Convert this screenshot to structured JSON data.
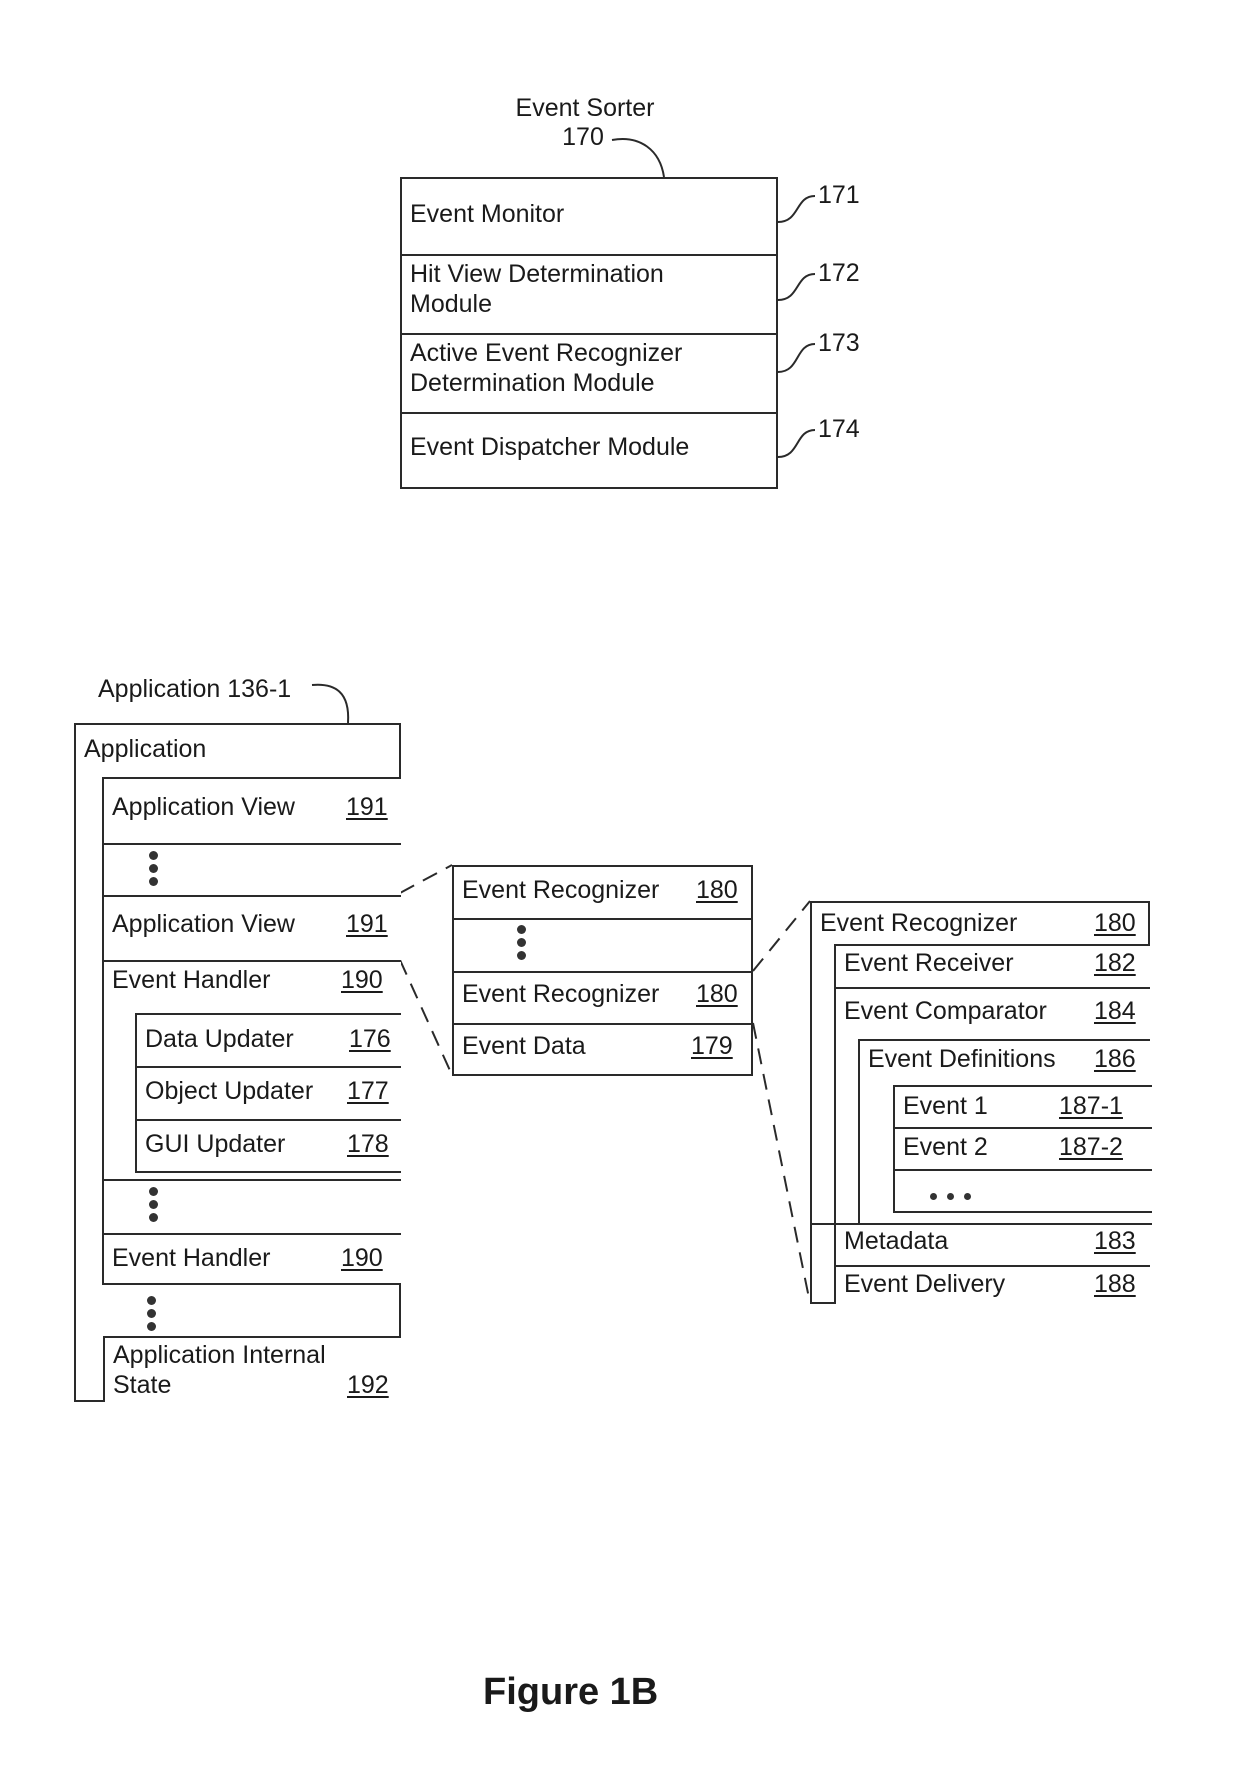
{
  "event_sorter": {
    "title": "Event Sorter",
    "ref": "170",
    "modules": [
      {
        "lines": [
          "Event Monitor"
        ],
        "ref": "171"
      },
      {
        "lines": [
          "Hit View Determination",
          "Module"
        ],
        "ref": "172"
      },
      {
        "lines": [
          "Active Event Recognizer",
          "Determination Module"
        ],
        "ref": "173"
      },
      {
        "lines": [
          "Event Dispatcher Module"
        ],
        "ref": "174"
      }
    ]
  },
  "application": {
    "caption": "Application 136-1",
    "header": "Application",
    "app_view_1": {
      "label": "Application View",
      "ref": "191"
    },
    "app_view_2": {
      "label": "Application View",
      "ref": "191"
    },
    "event_handler_1": {
      "label": "Event Handler",
      "ref": "190"
    },
    "updaters": [
      {
        "label": "Data Updater",
        "ref": "176"
      },
      {
        "label": "Object Updater",
        "ref": "177"
      },
      {
        "label": "GUI Updater",
        "ref": "178"
      }
    ],
    "event_handler_2": {
      "label": "Event Handler",
      "ref": "190"
    },
    "internal_state": {
      "line1": "Application Internal",
      "line2": "State",
      "ref": "192"
    }
  },
  "recognizers": {
    "rec_1": {
      "label": "Event Recognizer",
      "ref": "180"
    },
    "rec_2": {
      "label": "Event Recognizer",
      "ref": "180"
    },
    "event_data": {
      "label": "Event Data",
      "ref": "179"
    }
  },
  "recognizer_detail": {
    "header": {
      "label": "Event Recognizer",
      "ref": "180"
    },
    "receiver": {
      "label": "Event Receiver",
      "ref": "182"
    },
    "comparator": {
      "label": "Event Comparator",
      "ref": "184"
    },
    "definitions": {
      "label": "Event Definitions",
      "ref": "186"
    },
    "events": [
      {
        "label": "Event 1",
        "ref": "187-1"
      },
      {
        "label": "Event 2",
        "ref": "187-2"
      }
    ],
    "metadata": {
      "label": "Metadata",
      "ref": "183"
    },
    "delivery": {
      "label": "Event Delivery",
      "ref": "188"
    }
  },
  "figure_label": "Figure 1B"
}
